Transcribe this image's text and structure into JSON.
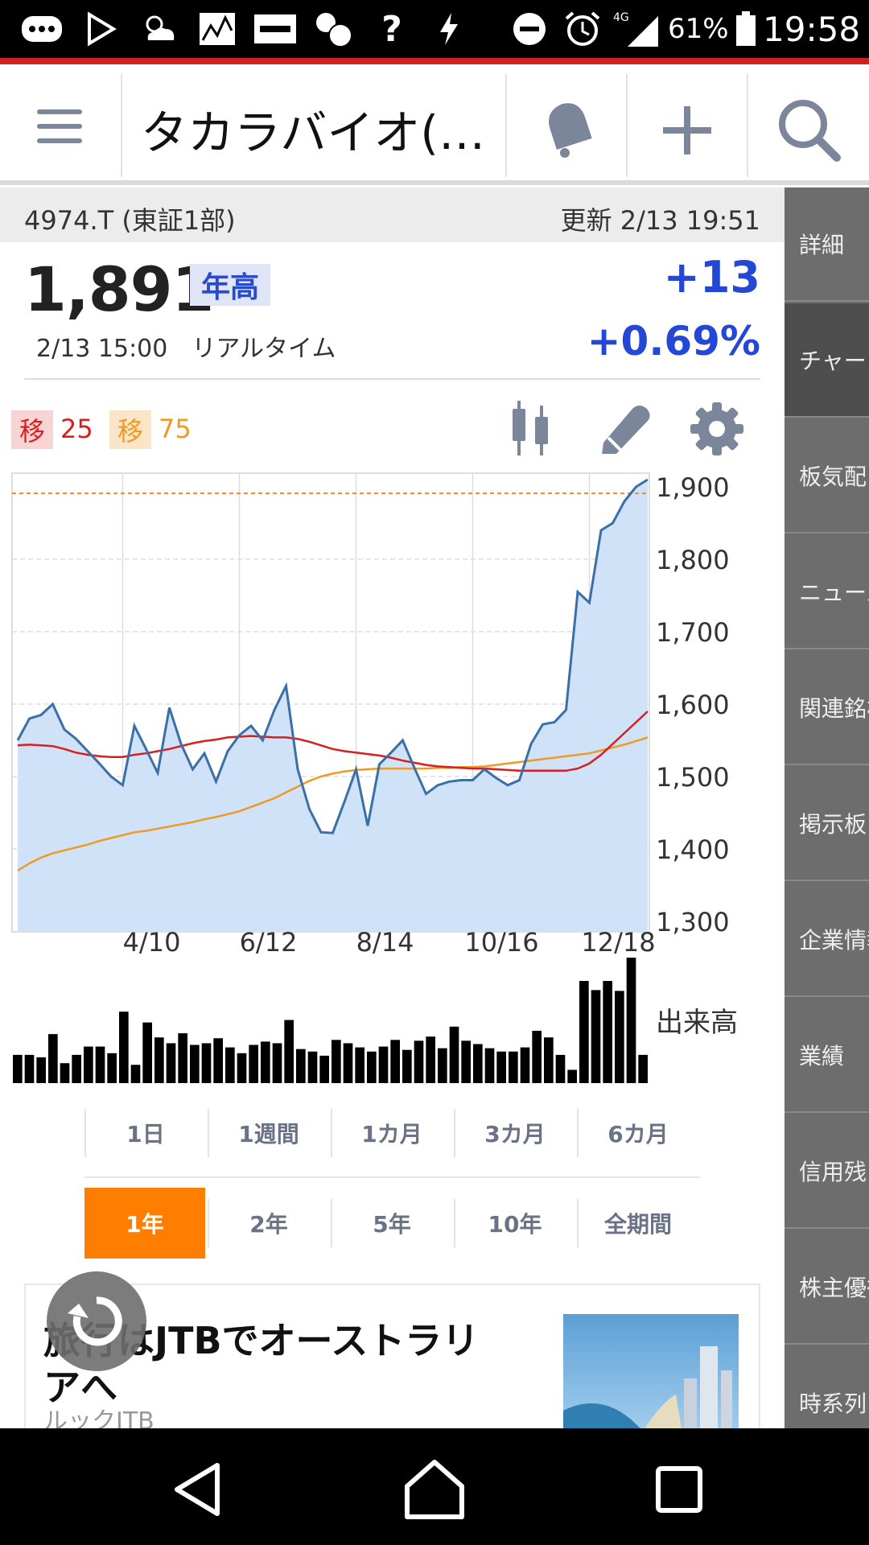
{
  "status_bar": {
    "network": "4G",
    "battery": "61%",
    "time": "19:58",
    "icons": [
      "more-icon",
      "play-store-icon",
      "weather-icon",
      "stock-icon",
      "yahoo-auction-icon",
      "bubbles-icon",
      "question-icon",
      "flash-icon",
      "do-not-disturb-icon",
      "alarm-icon",
      "signal-icon",
      "battery-icon"
    ]
  },
  "header": {
    "title": "タカラバイオ(…",
    "icons": [
      "menu-icon",
      "bell-icon",
      "plus-icon",
      "search-icon"
    ]
  },
  "info": {
    "ticker": "4974.T (東証1部)",
    "updated": "更新 2/13 19:51",
    "price": "1,891",
    "badge": "年高",
    "change": "+13",
    "change_pct": "+0.69%",
    "price_time": "2/13 15:00　リアルタイム"
  },
  "moving_averages": {
    "ma1_label": "移",
    "ma1_value": "25",
    "ma2_label": "移",
    "ma2_value": "75",
    "ma1_color": "#d81e1e",
    "ma2_color": "#ef9a22"
  },
  "chart_toolbar": {
    "icons": [
      "candlestick-icon",
      "draw-icon",
      "gear-icon"
    ]
  },
  "sidebar": {
    "items": [
      {
        "label": "詳細",
        "active": false
      },
      {
        "label": "チャート",
        "active": true
      },
      {
        "label": "板気配",
        "active": false
      },
      {
        "label": "ニュース",
        "active": false
      },
      {
        "label": "関連銘柄",
        "active": false
      },
      {
        "label": "掲示板",
        "active": false
      },
      {
        "label": "企業情報",
        "active": false
      },
      {
        "label": "業績",
        "active": false
      },
      {
        "label": "信用残",
        "active": false
      },
      {
        "label": "株主優待",
        "active": false
      },
      {
        "label": "時系列",
        "active": false
      }
    ]
  },
  "chart_data": {
    "type": "line",
    "y_ticks": [
      "1,900",
      "1,800",
      "1,700",
      "1,600",
      "1,500",
      "1,400",
      "1,300"
    ],
    "ylim": [
      1300,
      1900
    ],
    "x_ticks": [
      "4/10",
      "6/12",
      "8/14",
      "10/16",
      "12/18"
    ],
    "volume_label": "出来高",
    "reference_line": 1891,
    "series": [
      {
        "values": [
          1550,
          1580,
          1585,
          1600,
          1565,
          1552,
          1535,
          1518,
          1500,
          1488,
          1570,
          1538,
          1505,
          1595,
          1545,
          1510,
          1532,
          1493,
          1535,
          1557,
          1570,
          1550,
          1592,
          1625,
          1510,
          1455,
          1423,
          1422,
          1465,
          1510,
          1432,
          1517,
          1533,
          1550,
          1512,
          1476,
          1488,
          1493,
          1495,
          1495,
          1510,
          1498,
          1488,
          1495,
          1545,
          1572,
          1575,
          1592,
          1755,
          1740,
          1840,
          1850,
          1880,
          1900,
          1910
        ]
      },
      {
        "values": [
          1543,
          1544,
          1543,
          1542,
          1538,
          1533,
          1530,
          1528,
          1527,
          1527,
          1530,
          1532,
          1535,
          1538,
          1542,
          1546,
          1549,
          1551,
          1554,
          1555,
          1556,
          1555,
          1554,
          1554,
          1552,
          1548,
          1543,
          1538,
          1535,
          1533,
          1531,
          1529,
          1526,
          1522,
          1519,
          1516,
          1514,
          1513,
          1512,
          1511,
          1511,
          1510,
          1509,
          1508,
          1508,
          1508,
          1508,
          1508,
          1511,
          1518,
          1530,
          1545,
          1560,
          1575,
          1590
        ]
      },
      {
        "values": [
          1370,
          1380,
          1388,
          1394,
          1398,
          1402,
          1406,
          1411,
          1415,
          1419,
          1423,
          1425,
          1428,
          1431,
          1434,
          1437,
          1441,
          1444,
          1448,
          1452,
          1458,
          1464,
          1470,
          1478,
          1486,
          1494,
          1500,
          1504,
          1507,
          1509,
          1510,
          1511,
          1511,
          1511,
          1511,
          1511,
          1512,
          1512,
          1513,
          1513,
          1514,
          1516,
          1518,
          1520,
          1522,
          1524,
          1526,
          1528,
          1530,
          1532,
          1536,
          1540,
          1544,
          1549,
          1554
        ]
      }
    ],
    "volume": [
      3.4,
      3.4,
      3.1,
      5.9,
      2.4,
      3.4,
      4.4,
      4.4,
      3.6,
      8.6,
      2.2,
      7.3,
      5.5,
      4.8,
      6.0,
      4.6,
      4.8,
      5.4,
      4.3,
      3.6,
      4.6,
      5.0,
      4.8,
      7.6,
      4.1,
      3.8,
      3.3,
      5.2,
      4.8,
      4.3,
      3.8,
      4.4,
      5.2,
      4.0,
      5.1,
      5.6,
      4.2,
      6.8,
      5.1,
      4.7,
      4.2,
      3.8,
      3.8,
      4.3,
      6.3,
      5.5,
      3.4,
      1.6,
      12.3,
      11.2,
      12.3,
      11.1,
      15.1,
      3.4
    ]
  },
  "periods": {
    "row1": [
      "1日",
      "1週間",
      "1カ月",
      "3カ月",
      "6カ月"
    ],
    "row2": [
      "1年",
      "2年",
      "5年",
      "10年",
      "全期間"
    ],
    "active": "1年"
  },
  "ad": {
    "title": "旅行はJTBでオーストラリアへ",
    "source": "ルックJTB"
  },
  "nav": {
    "icons": [
      "back-icon",
      "home-icon",
      "recents-icon"
    ]
  }
}
